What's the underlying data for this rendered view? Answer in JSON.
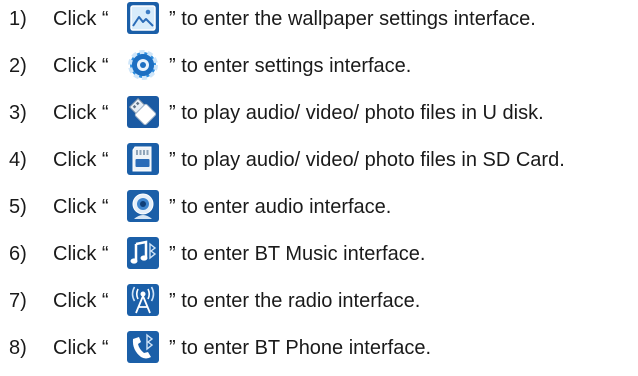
{
  "click_label": "Click “",
  "instructions": [
    {
      "number": "1)",
      "icon": "wallpaper-icon",
      "text": "” to enter the wallpaper settings interface."
    },
    {
      "number": "2)",
      "icon": "settings-gear-icon",
      "text": "” to enter settings interface."
    },
    {
      "number": "3)",
      "icon": "usb-disk-icon",
      "text": "” to play audio/ video/ photo files in U disk."
    },
    {
      "number": "4)",
      "icon": "sd-card-icon",
      "text": "” to play audio/ video/ photo files in SD Card."
    },
    {
      "number": "5)",
      "icon": "audio-webcam-icon",
      "text": "” to enter audio interface."
    },
    {
      "number": "6)",
      "icon": "bt-music-icon",
      "text": "” to enter BT Music interface."
    },
    {
      "number": "7)",
      "icon": "radio-antenna-icon",
      "text": "” to enter the radio interface."
    },
    {
      "number": "8)",
      "icon": "bt-phone-icon",
      "text": "” to enter BT Phone interface."
    }
  ]
}
